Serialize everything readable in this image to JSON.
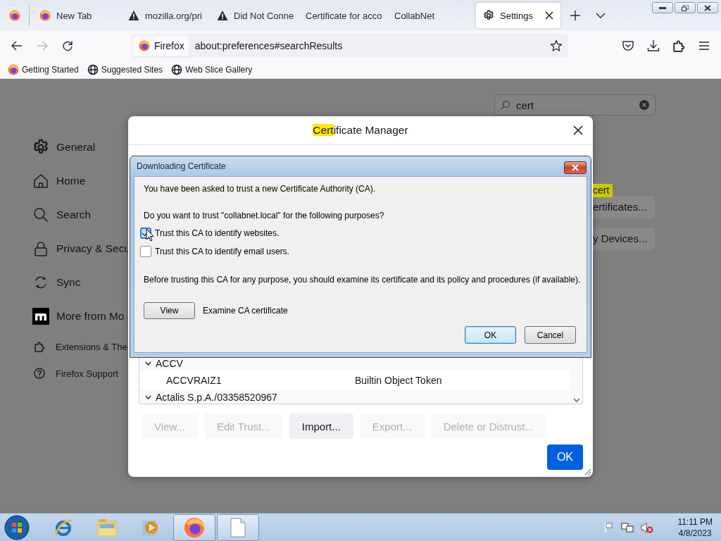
{
  "browser": {
    "tabs": [
      {
        "label": "New Tab",
        "kind": "firefox",
        "selected": false
      },
      {
        "label": "mozilla.org/pri",
        "kind": "warning",
        "selected": false
      },
      {
        "label": "Did Not Conne",
        "kind": "warning",
        "selected": false
      },
      {
        "label": "Certificate for acco",
        "kind": "plain",
        "selected": false
      },
      {
        "label": "CollabNet",
        "kind": "plain",
        "selected": false
      },
      {
        "label": "Settings",
        "kind": "gear",
        "selected": true
      }
    ],
    "address_bar": {
      "identity": "Firefox",
      "url": "about:preferences#searchResults"
    },
    "bookmarks": [
      {
        "label": "Getting Started",
        "kind": "firefox"
      },
      {
        "label": "Suggested Sites",
        "kind": "globe"
      },
      {
        "label": "Web Slice Gallery",
        "kind": "globe"
      }
    ]
  },
  "settings": {
    "search": {
      "value": "cert"
    },
    "nav": [
      {
        "label": "General",
        "kind": "gear"
      },
      {
        "label": "Home",
        "kind": "home"
      },
      {
        "label": "Search",
        "kind": "search"
      },
      {
        "label": "Privacy & Secu",
        "kind": "lock"
      },
      {
        "label": "Sync",
        "kind": "sync"
      },
      {
        "label": "More from Mo",
        "kind": "logo"
      }
    ],
    "footer": [
      {
        "label": "Extensions & The",
        "kind": "puzzle"
      },
      {
        "label": "Firefox Support",
        "kind": "help"
      }
    ],
    "search_tag": "cert",
    "buttons": [
      "ertificates...",
      "y Devices..."
    ]
  },
  "certificate_manager": {
    "title": [
      {
        "text": "Cert",
        "highlighted": true
      },
      {
        "text": "ificate Manager",
        "highlighted": false
      }
    ],
    "list": [
      {
        "kind": "group",
        "label": "ACCV",
        "expanded": true,
        "children": [
          {
            "kind": "cert",
            "name": "ACCVRAIZ1",
            "token": "Builtin Object Token"
          }
        ]
      },
      {
        "kind": "group",
        "label": "Actalis S.p.A./03358520967",
        "expanded": true
      }
    ],
    "buttons": [
      {
        "label": "View...",
        "disabled": true
      },
      {
        "label": "Edit Trust...",
        "disabled": true
      },
      {
        "label": "Import...",
        "disabled": false
      },
      {
        "label": "Export...",
        "disabled": true
      },
      {
        "label": "Delete or Distrust...",
        "disabled": true
      }
    ],
    "ok": "OK"
  },
  "download_dialog": {
    "title": "Downloading Certificate",
    "intro": "You have been asked to trust a new Certificate Authority (CA).",
    "question": "Do you want to trust \"collabnet.local\" for the following purposes?",
    "options": [
      {
        "label": "Trust this CA to identify websites.",
        "checked": true,
        "focused": true
      },
      {
        "label": "Trust this CA to identify email users.",
        "checked": false,
        "focused": false
      }
    ],
    "advice": "Before trusting this CA for any purpose, you should examine its certificate and its policy and procedures (if available).",
    "view_button": "View",
    "view_caption": "Examine CA certificate",
    "buttons": [
      {
        "label": "OK",
        "default": true
      },
      {
        "label": "Cancel",
        "default": false
      }
    ]
  },
  "taskbar": {
    "apps": [
      {
        "kind": "ie",
        "open": false
      },
      {
        "kind": "explorer",
        "open": false
      },
      {
        "kind": "media",
        "open": false
      },
      {
        "kind": "firefox",
        "open": true
      },
      {
        "kind": "document",
        "open": true
      }
    ],
    "time": "11:11 PM",
    "date": "4/8/2023"
  }
}
